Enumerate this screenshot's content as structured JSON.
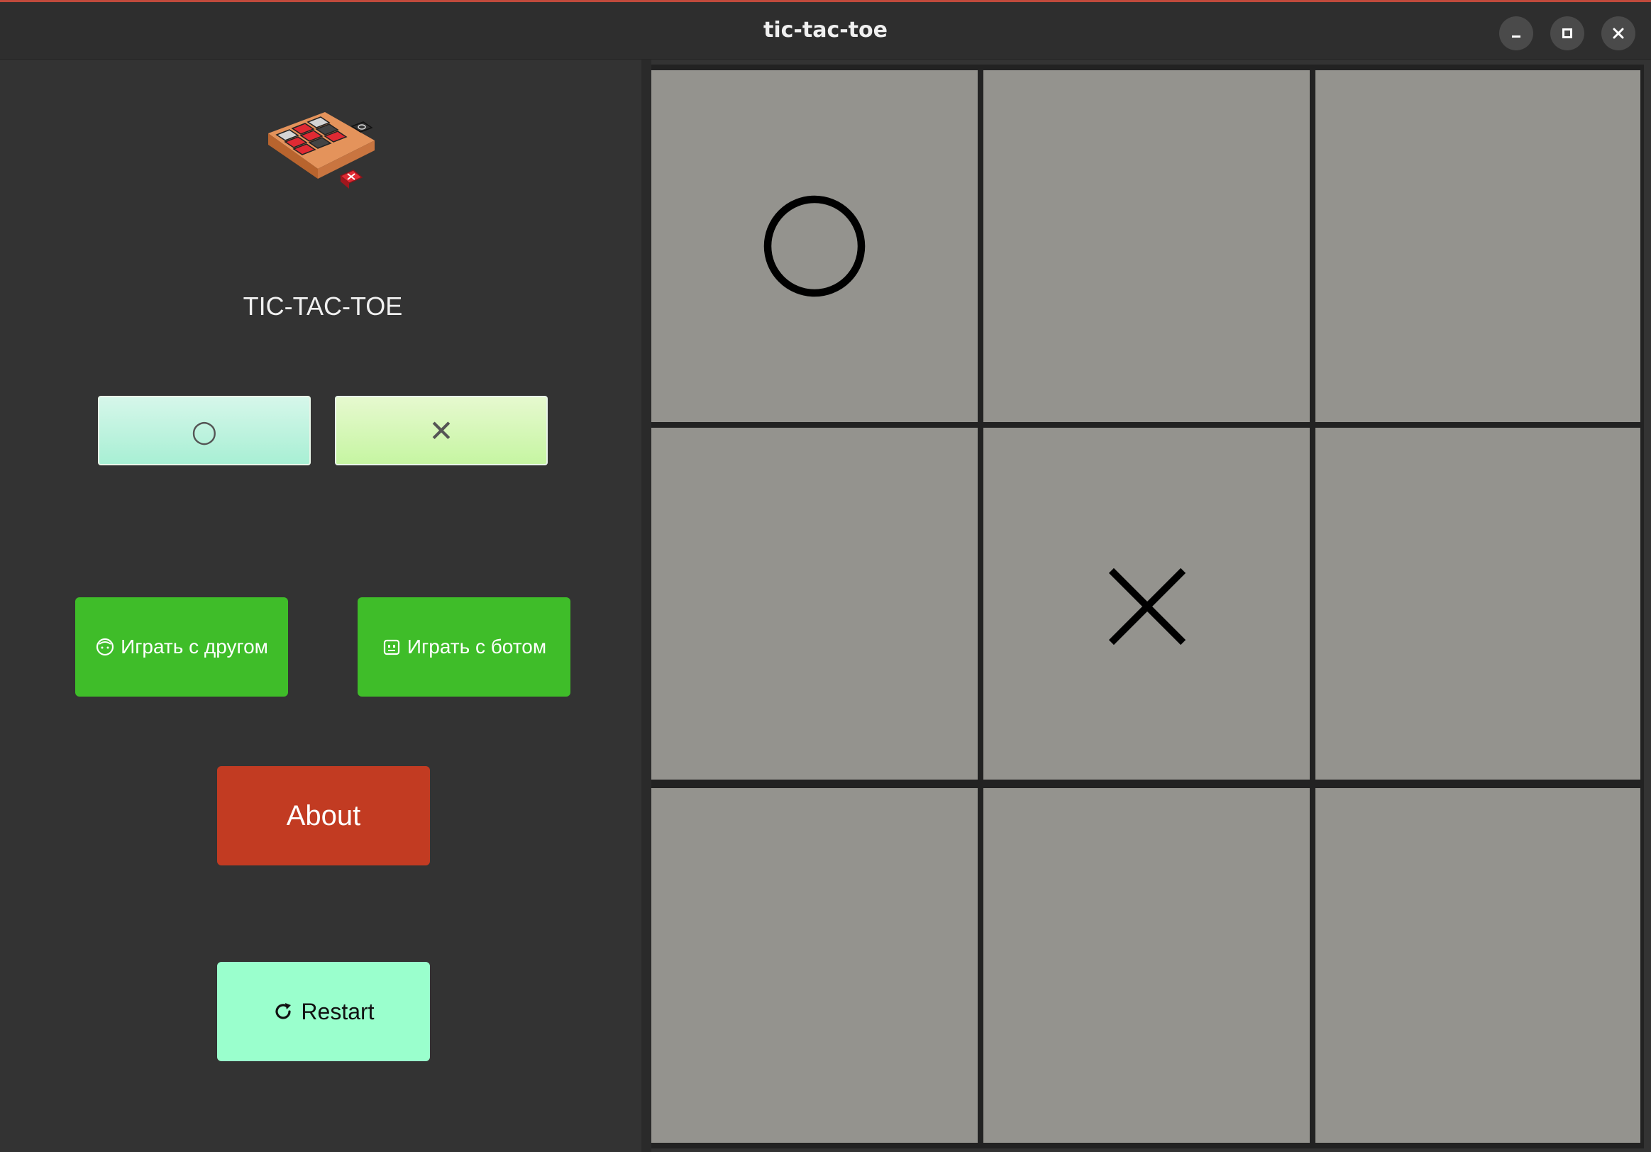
{
  "window": {
    "title": "tic-tac-toe",
    "controls": [
      "minimize-icon",
      "maximize-icon",
      "close-icon"
    ]
  },
  "sidebar": {
    "logo": "tic-tac-toe-logo",
    "app_title": "TIC-TAC-TOE",
    "symbol_choices": [
      {
        "label": "○",
        "icon": "circle-icon"
      },
      {
        "label": "✕",
        "icon": "cross-icon"
      }
    ],
    "modes": [
      {
        "label": "Играть с другом",
        "icon": "face-icon"
      },
      {
        "label": "Играть с ботом",
        "icon": "robot-icon"
      }
    ],
    "about_label": "About",
    "restart_label": "Restart",
    "restart_icon": "refresh-icon"
  },
  "board": {
    "cells": [
      "O",
      "",
      "",
      "",
      "X",
      "",
      "",
      "",
      ""
    ]
  },
  "colors": {
    "background": "#333333",
    "cell": "#94938e",
    "grid_line": "#222222",
    "mode_button": "#3fbd29",
    "about_button": "#c23b22",
    "restart_button": "#9affcd"
  }
}
